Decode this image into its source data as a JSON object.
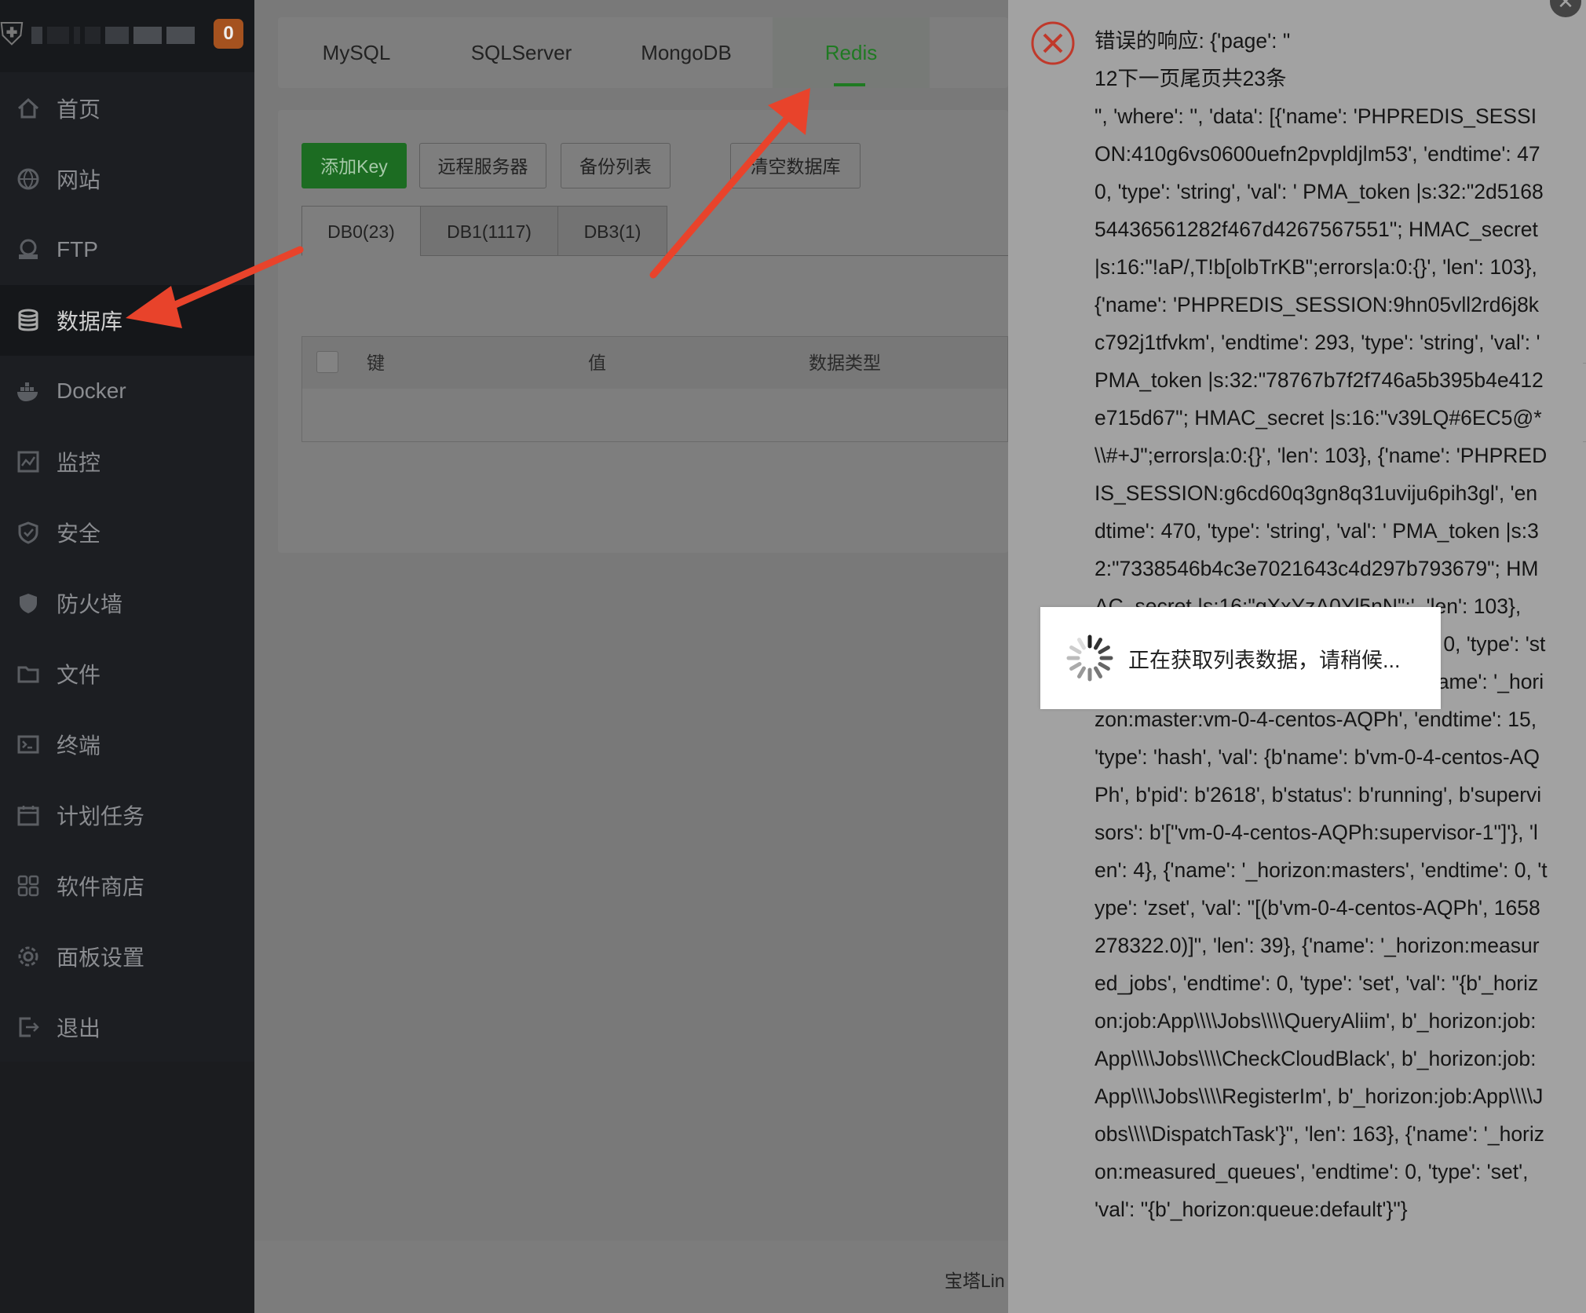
{
  "sidebar": {
    "badge": "0",
    "items": [
      {
        "label": "首页",
        "icon": "home-icon"
      },
      {
        "label": "网站",
        "icon": "globe-icon"
      },
      {
        "label": "FTP",
        "icon": "ftp-icon"
      },
      {
        "label": "数据库",
        "icon": "database-icon"
      },
      {
        "label": "Docker",
        "icon": "docker-icon"
      },
      {
        "label": "监控",
        "icon": "monitor-icon"
      },
      {
        "label": "安全",
        "icon": "shield-icon"
      },
      {
        "label": "防火墙",
        "icon": "firewall-icon"
      },
      {
        "label": "文件",
        "icon": "folder-icon"
      },
      {
        "label": "终端",
        "icon": "terminal-icon"
      },
      {
        "label": "计划任务",
        "icon": "calendar-icon"
      },
      {
        "label": "软件商店",
        "icon": "apps-icon"
      },
      {
        "label": "面板设置",
        "icon": "gear-icon"
      },
      {
        "label": "退出",
        "icon": "logout-icon"
      }
    ],
    "active": "数据库"
  },
  "tabs": [
    {
      "label": "MySQL"
    },
    {
      "label": "SQLServer"
    },
    {
      "label": "MongoDB"
    },
    {
      "label": "Redis"
    }
  ],
  "active_tab": "Redis",
  "toolbar": {
    "add_key": "添加Key",
    "remote_server": "远程服务器",
    "backup_list": "备份列表",
    "clear_db": "清空数据库"
  },
  "db_tabs": [
    {
      "label": "DB0(23)"
    },
    {
      "label": "DB1(1117)"
    },
    {
      "label": "DB3(1)"
    }
  ],
  "table": {
    "headers": [
      "键",
      "值",
      "数据类型"
    ]
  },
  "footer": "宝塔Lin",
  "error": {
    "text": "错误的响应: {'page': \"\n12下一页尾页共23条\n\", 'where': '', 'data': [{'name': 'PHPREDIS_SESSION:410g6vs0600uefn2pvpldjlm53', 'endtime': 470, 'type': 'string', 'val': ' PMA_token |s:32:\"2d516854436561282f467d4267567551\"; HMAC_secret |s:16:\"!aP/,T!b[olbTrKB\";errors|a:0:{}', 'len': 103}, {'name': 'PHPREDIS_SESSION:9hn05vll2rd6j8kc792j1tfvkm', 'endtime': 293, 'type': 'string', 'val': ' PMA_token |s:32:\"78767b7f2f746a5b395b4e412e715d67\"; HMAC_secret |s:16:\"v39LQ#6EC5@*\\\\#+J\";errors|a:0:{}', 'len': 103}, {'name': 'PHPREDIS_SESSION:g6cd60q3gn8q31uviju6pih3gl', 'endtime': 470, 'type': 'string', 'val': ' PMA_token |s:32:\"7338546b4c3e7021643c4d297b793679\"; HMAC_secret |s:16:\"qXxYzA0Yl5nN\";', 'len': 103}, {'name': 'last_snapshot_at', 'endtime': 0, 'type': 'string', 'val': '1658278202', 'len': 10}, {'name': '_horizon:master:vm-0-4-centos-AQPh', 'endtime': 15, 'type': 'hash', 'val': {b'name': b'vm-0-4-centos-AQPh', b'pid': b'2618', b'status': b'running', b'supervisors': b'[\"vm-0-4-centos-AQPh:supervisor-1\"]'}, 'len': 4}, {'name': '_horizon:masters', 'endtime': 0, 'type': 'zset', 'val': \"[(b'vm-0-4-centos-AQPh', 1658278322.0)]\", 'len': 39}, {'name': '_horizon:measured_jobs', 'endtime': 0, 'type': 'set', 'val': \"{b'_horizon:job:App\\\\\\\\Jobs\\\\\\\\QueryAliim', b'_horizon:job:App\\\\\\\\Jobs\\\\\\\\CheckCloudBlack', b'_horizon:job:App\\\\\\\\Jobs\\\\\\\\RegisterIm', b'_horizon:job:App\\\\\\\\Jobs\\\\\\\\DispatchTask'}\", 'len': 163}, {'name': '_horizon:measured_queues', 'endtime': 0, 'type': 'set', 'val': \"{b'_horizon:queue:default'}\"}"
  },
  "loading": {
    "text": "正在获取列表数据，请稍候..."
  },
  "colors": {
    "sidebar_bg": "#1c1e22",
    "active_tab": "#1f7a22",
    "primary_button": "#1c6c22",
    "badge": "#a5521f",
    "arrow": "#e8432b",
    "error_icon": "#c0392b"
  }
}
